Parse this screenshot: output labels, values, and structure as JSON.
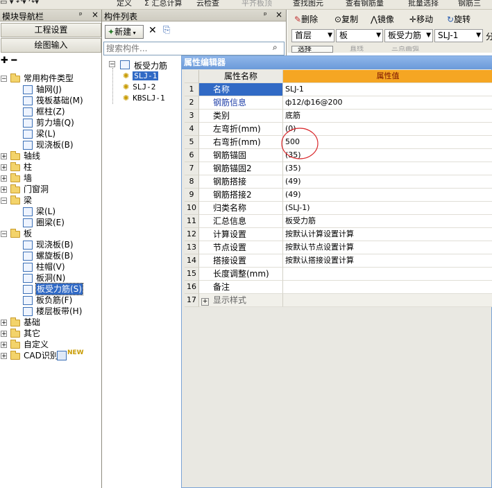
{
  "top_toolbar": {
    "items": [
      "定义",
      "Σ 汇总计算",
      "云检查",
      "平齐板顶",
      "查找图元",
      "查看钢筋量",
      "批量选择",
      "钢筋三"
    ]
  },
  "nav": {
    "title": "模块导航栏",
    "pin": "ᵖ",
    "close": "×",
    "buttons": [
      "工程设置",
      "绘图输入"
    ],
    "tree": [
      {
        "id": "cat-common",
        "label": "常用构件类型",
        "level": 0,
        "expanded": true,
        "type": "folder"
      },
      {
        "id": "axis-net",
        "label": "轴网(J)",
        "level": 1,
        "type": "item"
      },
      {
        "id": "raft-foundation",
        "label": "筏板基础(M)",
        "level": 1,
        "type": "item"
      },
      {
        "id": "column-cap",
        "label": "框柱(Z)",
        "level": 1,
        "type": "item"
      },
      {
        "id": "shear-wall",
        "label": "剪力墙(Q)",
        "level": 1,
        "type": "item"
      },
      {
        "id": "beam",
        "label": "梁(L)",
        "level": 1,
        "type": "item"
      },
      {
        "id": "cast-slab",
        "label": "现浇板(B)",
        "level": 1,
        "type": "item"
      },
      {
        "id": "cat-axis",
        "label": "轴线",
        "level": 0,
        "expanded": false,
        "type": "folder"
      },
      {
        "id": "cat-column",
        "label": "柱",
        "level": 0,
        "expanded": false,
        "type": "folder"
      },
      {
        "id": "cat-wall",
        "label": "墙",
        "level": 0,
        "expanded": false,
        "type": "folder"
      },
      {
        "id": "cat-door",
        "label": "门窗洞",
        "level": 0,
        "expanded": false,
        "type": "folder"
      },
      {
        "id": "cat-beam",
        "label": "梁",
        "level": 0,
        "expanded": true,
        "type": "folder"
      },
      {
        "id": "beam-l",
        "label": "梁(L)",
        "level": 1,
        "type": "item"
      },
      {
        "id": "ring-beam",
        "label": "圈梁(E)",
        "level": 1,
        "type": "item"
      },
      {
        "id": "cat-slab",
        "label": "板",
        "level": 0,
        "expanded": true,
        "type": "folder"
      },
      {
        "id": "slab-cast",
        "label": "现浇板(B)",
        "level": 1,
        "type": "item"
      },
      {
        "id": "spiral-slab",
        "label": "螺旋板(B)",
        "level": 1,
        "type": "item"
      },
      {
        "id": "col-cap",
        "label": "柱帽(V)",
        "level": 1,
        "type": "item"
      },
      {
        "id": "slab-hole",
        "label": "板洞(N)",
        "level": 1,
        "type": "item"
      },
      {
        "id": "slab-stressed-rebar",
        "label": "板受力筋(S)",
        "level": 1,
        "type": "item",
        "selected": true
      },
      {
        "id": "slab-neg-rebar",
        "label": "板负筋(F)",
        "level": 1,
        "type": "item"
      },
      {
        "id": "floor-band",
        "label": "楼层板带(H)",
        "level": 1,
        "type": "item"
      },
      {
        "id": "cat-foundation",
        "label": "基础",
        "level": 0,
        "expanded": false,
        "type": "folder"
      },
      {
        "id": "cat-other",
        "label": "其它",
        "level": 0,
        "expanded": false,
        "type": "folder"
      },
      {
        "id": "cat-custom",
        "label": "自定义",
        "level": 0,
        "expanded": false,
        "type": "folder"
      },
      {
        "id": "cat-cad",
        "label": "CAD识别",
        "level": 0,
        "expanded": false,
        "type": "folder",
        "badge": "NEW"
      }
    ]
  },
  "component_list": {
    "title": "构件列表",
    "pin": "ᵖ",
    "close": "×",
    "new_label": "新建",
    "delete_icon": "✕",
    "copy_icon": "⎘",
    "search_placeholder": "搜索构件...",
    "tree_root": "板受力筋",
    "items": [
      "SLJ-1",
      "SLJ-2",
      "KBSLJ-1"
    ],
    "selected": "SLJ-1"
  },
  "right_toolbar": {
    "row1": [
      "删除",
      "复制",
      "镜像",
      "移动",
      "旋转"
    ],
    "floor": "首层",
    "category": "板",
    "type": "板受力筋",
    "name": "SLJ-1",
    "extra": "分",
    "row3": [
      "选择",
      "直线",
      "三点画弧"
    ]
  },
  "property_editor": {
    "title": "属性编辑器",
    "header": {
      "name": "属性名称",
      "value": "属性值"
    },
    "rows": [
      {
        "n": "1",
        "name": "名称",
        "value": "SLJ-1",
        "style": "selected"
      },
      {
        "n": "2",
        "name": "钢筋信息",
        "value": "ф12/ф16@200",
        "style": "blue"
      },
      {
        "n": "3",
        "name": "类别",
        "value": "底筋",
        "style": "normal"
      },
      {
        "n": "4",
        "name": "左弯折(mm)",
        "value": "(0)",
        "style": "normal"
      },
      {
        "n": "5",
        "name": "右弯折(mm)",
        "value": "500",
        "style": "normal"
      },
      {
        "n": "6",
        "name": "钢筋锚固",
        "value": "(35)",
        "style": "normal"
      },
      {
        "n": "7",
        "name": "钢筋锚固2",
        "value": "(35)",
        "style": "normal"
      },
      {
        "n": "8",
        "name": "钢筋搭接",
        "value": "(49)",
        "style": "normal"
      },
      {
        "n": "9",
        "name": "钢筋搭接2",
        "value": "(49)",
        "style": "normal"
      },
      {
        "n": "10",
        "name": "归类名称",
        "value": "(SLJ-1)",
        "style": "normal"
      },
      {
        "n": "11",
        "name": "汇总信息",
        "value": "板受力筋",
        "style": "normal"
      },
      {
        "n": "12",
        "name": "计算设置",
        "value": "按默认计算设置计算",
        "style": "normal"
      },
      {
        "n": "13",
        "name": "节点设置",
        "value": "按默认节点设置计算",
        "style": "normal"
      },
      {
        "n": "14",
        "name": "搭接设置",
        "value": "按默认搭接设置计算",
        "style": "normal"
      },
      {
        "n": "15",
        "name": "长度调整(mm)",
        "value": "",
        "style": "normal"
      },
      {
        "n": "16",
        "name": "备注",
        "value": "",
        "style": "normal"
      },
      {
        "n": "17",
        "name": "显示样式",
        "value": "",
        "style": "group"
      }
    ]
  },
  "colors": {
    "accent": "#f5a623",
    "selection": "#316ac5",
    "title_blue": "#7aa3d6",
    "annotation_red": "#d9262a"
  }
}
